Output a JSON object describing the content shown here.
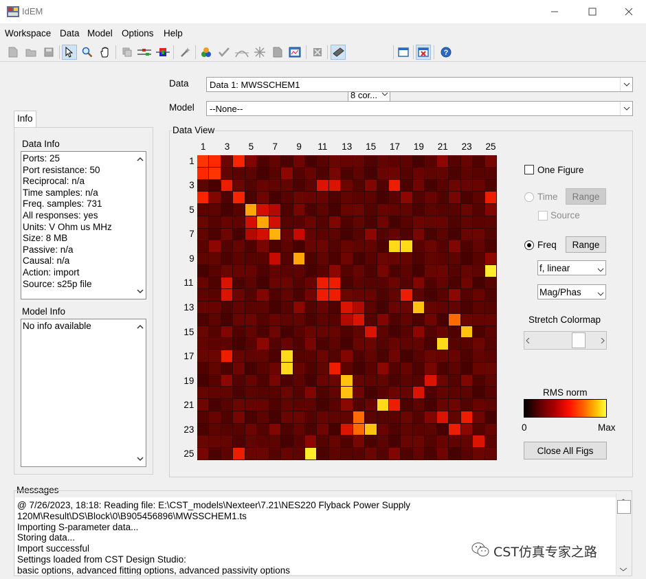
{
  "window": {
    "title": "IdEM"
  },
  "menu": [
    "Workspace",
    "Data",
    "Model",
    "Options",
    "Help"
  ],
  "toolbar": {
    "cores_label": "8 cor...",
    "icons": [
      "new-icon",
      "open-icon",
      "save-icon",
      "pointer-icon",
      "zoom-icon",
      "pan-icon",
      "copy-icon",
      "port-icon",
      "flag-icon",
      "wand-icon",
      "fit-icon",
      "check-icon",
      "passivity-icon",
      "star-icon",
      "export-icon",
      "report-icon",
      "stop-icon",
      "model-icon",
      "cores-dropdown",
      "window-icon",
      "close-figs-icon",
      "help-icon"
    ]
  },
  "data_selector": {
    "label": "Data",
    "value": "Data 1: MWSSCHEM1"
  },
  "model_selector": {
    "label": "Model",
    "value": "--None--"
  },
  "info_tab": "Info",
  "data_info": {
    "title": "Data Info",
    "lines": [
      "Ports: 25",
      "Port resistance: 50",
      "Reciprocal: n/a",
      "Time samples: n/a",
      "Freq. samples: 731",
      "All responses: yes",
      "Units: V Ohm us MHz",
      "Size: 8 MB",
      "Passive: n/a",
      "Causal: n/a",
      "Action: import",
      "Source: s25p file"
    ]
  },
  "model_info": {
    "title": "Model Info",
    "lines": [
      "No info available"
    ]
  },
  "data_view": {
    "title": "Data View",
    "col_labels": [
      "1",
      "3",
      "5",
      "7",
      "9",
      "11",
      "13",
      "15",
      "17",
      "19",
      "21",
      "23",
      "25"
    ],
    "row_labels": [
      "1",
      "3",
      "5",
      "7",
      "9",
      "11",
      "13",
      "15",
      "17",
      "19",
      "21",
      "23",
      "25"
    ]
  },
  "view_controls": {
    "one_figure": "One Figure",
    "time": "Time",
    "time_range": "Range",
    "source": "Source",
    "freq": "Freq",
    "freq_range": "Range",
    "scale": "f, linear",
    "mode": "Mag/Phas",
    "stretch_label": "Stretch Colormap",
    "stretch_value": 0.75,
    "colorbar_title": "RMS norm",
    "colorbar_min": "0",
    "colorbar_max": "Max",
    "close_all": "Close All Figs"
  },
  "messages": {
    "title": "Messages",
    "lines": [
      "@ 7/26/2023, 18:18: Reading file: E:\\CST_models\\Nexteer\\7.21\\NES220 Flyback Power Supply",
      "120M\\Result\\DS\\Block\\0\\B905456896\\MWSSCHEM1.ts",
      "Importing S-parameter data...",
      "Storing data...",
      "Import successful",
      "Settings loaded from CST Design Studio:",
      "basic options, advanced fitting options, advanced passivity options"
    ]
  },
  "watermark": "CST仿真专家之路",
  "colors": {
    "dark": "#3a0000",
    "hot": "#ff3300",
    "max": "#ffff00"
  }
}
